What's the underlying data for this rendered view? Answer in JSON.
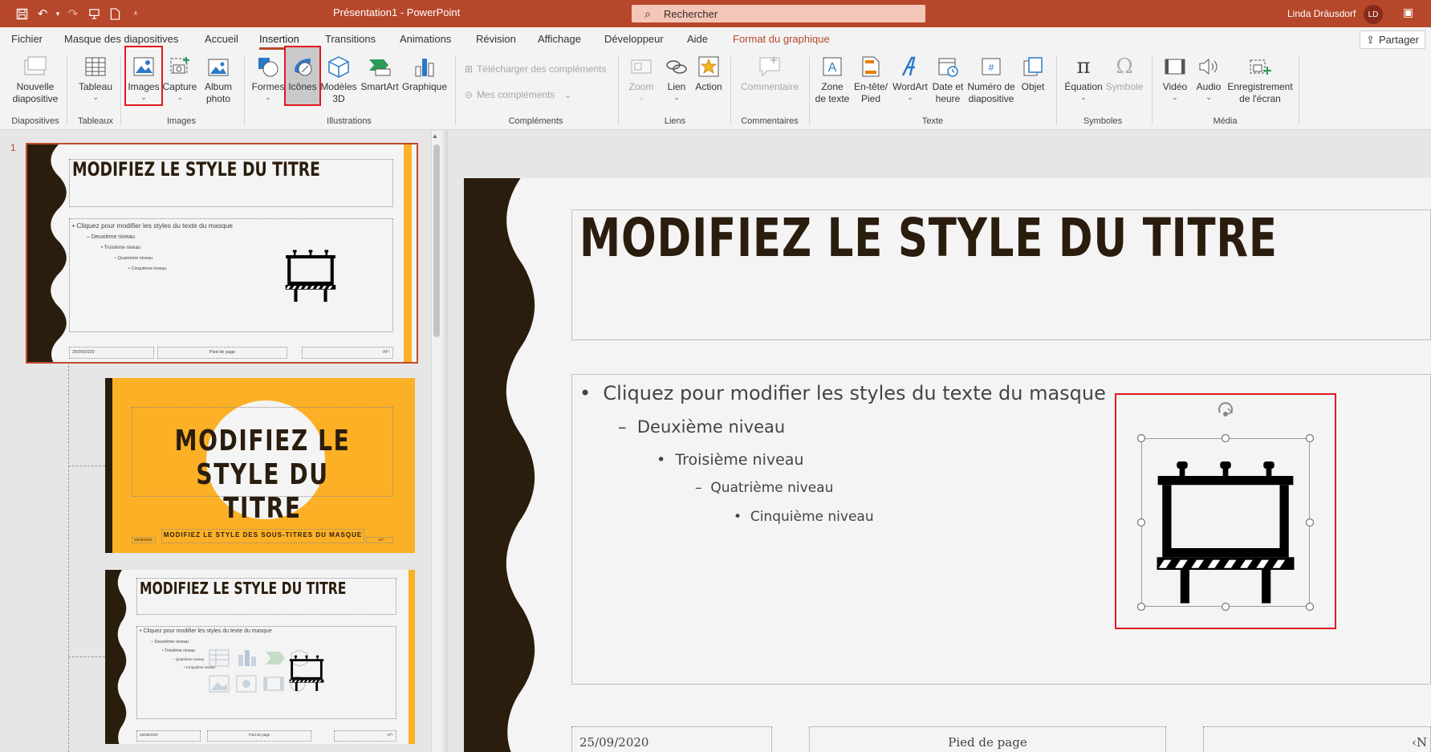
{
  "titlebar": {
    "title": "Présentation1  -  PowerPoint",
    "search_placeholder": "Rechercher",
    "user_name": "Linda Dräusdorf",
    "user_initials": "LD"
  },
  "menu": {
    "tabs": [
      "Fichier",
      "Masque des diapositives",
      "Accueil",
      "Insertion",
      "Transitions",
      "Animations",
      "Révision",
      "Affichage",
      "Développeur",
      "Aide",
      "Format du graphique"
    ],
    "active_tab": "Insertion",
    "share_label": "Partager"
  },
  "ribbon": {
    "buttons": {
      "nouvelle": "Nouvelle\ndiapositive",
      "tableau": "Tableau",
      "images": "Images",
      "capture": "Capture",
      "album": "Album\nphoto",
      "formes": "Formes",
      "icones": "Icônes",
      "modeles3d": "Modèles\n3D",
      "smartart": "SmartArt",
      "graphique": "Graphique",
      "telecharger": "Télécharger des compléments",
      "mes_complements": "Mes compléments",
      "zoom": "Zoom",
      "lien": "Lien",
      "action": "Action",
      "commentaire": "Commentaire",
      "zone_texte": "Zone\nde texte",
      "entete": "En-tête/\nPied",
      "wordart": "WordArt",
      "date_heure": "Date et\nheure",
      "numero": "Numéro de\ndiapositive",
      "objet": "Objet",
      "equation": "Équation",
      "symbole": "Symbole",
      "video": "Vidéo",
      "audio": "Audio",
      "enregistrement": "Enregistrement\nde l'écran"
    },
    "groups": {
      "diapositives": "Diapositives",
      "tableaux": "Tableaux",
      "images": "Images",
      "illustrations": "Illustrations",
      "complements": "Compléments",
      "liens": "Liens",
      "commentaires": "Commentaires",
      "texte": "Texte",
      "symboles": "Symboles",
      "media": "Média"
    }
  },
  "thumbnails": {
    "slide_number": "1",
    "master": {
      "title": "MODIFIEZ LE STYLE DU TITRE",
      "level1": "Cliquez pour modifier les styles du texte du masque",
      "level2": "Deuxième niveau",
      "level3": "Troisième niveau",
      "level4": "Quatrième niveau",
      "level5": "Cinquième niveau",
      "date": "25/09/2020",
      "footer": "Pied de page",
      "number": "‹N°›"
    },
    "layout1": {
      "title": "MODIFIEZ LE STYLE DU TITRE",
      "subtitle": "MODIFIEZ LE STYLE DES SOUS-TITRES DU MASQUE",
      "date": "25/09/2020",
      "number": "‹N°›"
    },
    "layout2": {
      "title": "MODIFIEZ LE STYLE DU TITRE",
      "level1": "Cliquez pour modifier les styles du texte du masque",
      "level2": "Deuxième niveau",
      "level3": "Troisième niveau",
      "level4": "Quatrième niveau",
      "level5": "Cinquième niveau",
      "date": "25/09/2020",
      "footer": "Pied de page",
      "number": "‹N°›"
    }
  },
  "slide": {
    "title": "MODIFIEZ LE STYLE DU TITRE",
    "bullets": [
      {
        "bullet": "•",
        "text": "Cliquez pour modifier les styles du texte du masque"
      },
      {
        "bullet": "–",
        "text": "Deuxième niveau"
      },
      {
        "bullet": "•",
        "text": "Troisième niveau"
      },
      {
        "bullet": "–",
        "text": "Quatrième niveau"
      },
      {
        "bullet": "•",
        "text": "Cinquième niveau"
      }
    ],
    "date": "25/09/2020",
    "footer": "Pied de page",
    "number": "‹N"
  },
  "colors": {
    "accent": "#b7472a",
    "highlight": "#e0191e",
    "slide_brown": "#2b1d0e",
    "slide_orange": "#fbb025"
  }
}
